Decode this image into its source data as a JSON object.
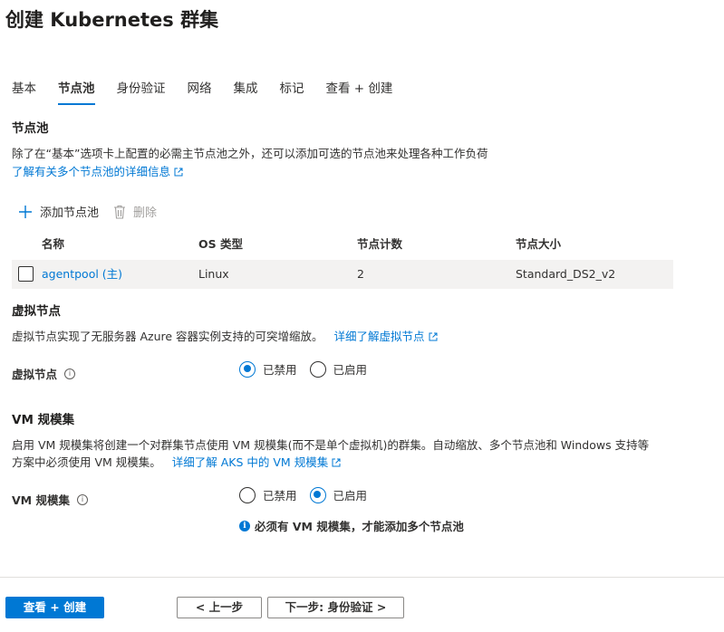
{
  "page": {
    "title": "创建 Kubernetes 群集"
  },
  "tabs": [
    {
      "label": "基本",
      "active": false
    },
    {
      "label": "节点池",
      "active": true
    },
    {
      "label": "身份验证",
      "active": false
    },
    {
      "label": "网络",
      "active": false
    },
    {
      "label": "集成",
      "active": false
    },
    {
      "label": "标记",
      "active": false
    },
    {
      "label": "查看 + 创建",
      "active": false
    }
  ],
  "node_pools": {
    "heading": "节点池",
    "description": "除了在“基本”选项卡上配置的必需主节点池之外，还可以添加可选的节点池来处理各种工作负荷",
    "learn_more": "了解有关多个节点池的详细信息",
    "add_label": "添加节点池",
    "delete_label": "删除",
    "columns": [
      "名称",
      "OS 类型",
      "节点计数",
      "节点大小"
    ],
    "rows": [
      {
        "name": "agentpool (主)",
        "os": "Linux",
        "count": "2",
        "size": "Standard_DS2_v2"
      }
    ]
  },
  "virtual_nodes": {
    "heading": "虚拟节点",
    "description": "虚拟节点实现了无服务器 Azure 容器实例支持的可突增缩放。",
    "learn_more": "详细了解虚拟节点",
    "field_label": "虚拟节点",
    "options": [
      "已禁用",
      "已启用"
    ],
    "selected": "已禁用"
  },
  "vm_scale_sets": {
    "heading": "VM 规模集",
    "description_line1": "启用 VM 规模集将创建一个对群集节点使用 VM 规模集(而不是单个虚拟机)的群集。自动缩放、多个节点池和 Windows 支持等",
    "description_line2": "方案中必须使用 VM 规模集。",
    "learn_more": "详细了解 AKS 中的 VM 规模集",
    "field_label": "VM 规模集",
    "options": [
      "已禁用",
      "已启用"
    ],
    "selected": "已启用",
    "note": "必须有 VM 规模集，才能添加多个节点池"
  },
  "footer": {
    "review_create": "查看 + 创建",
    "previous": "< 上一步",
    "next": "下一步: 身份验证 >"
  },
  "colors": {
    "accent": "#0078d4",
    "row_bg": "#f3f2f1"
  }
}
